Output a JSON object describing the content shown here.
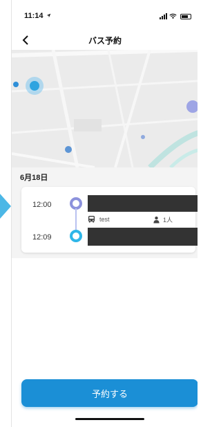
{
  "status_bar": {
    "time": "11:14"
  },
  "nav": {
    "title": "バス予約"
  },
  "trip": {
    "date": "6月18日",
    "departure_time": "12:00",
    "arrival_time": "12:09",
    "bus_name": "test",
    "passengers": "1人"
  },
  "actions": {
    "reserve_label": "予約する"
  },
  "icons": {
    "back": "chevron-left-icon",
    "bus": "bus-icon",
    "person": "person-icon",
    "location": "location-arrow-icon",
    "signal": "cellular-signal-icon",
    "wifi": "wifi-icon",
    "battery": "battery-icon"
  },
  "colors": {
    "primary": "#1b8fd6",
    "departure_dot": "#8c92dc",
    "arrival_dot": "#2fb6e8",
    "arrow": "#4cb7e6",
    "map_bg": "#ebebeb",
    "redacted": "#333333"
  }
}
